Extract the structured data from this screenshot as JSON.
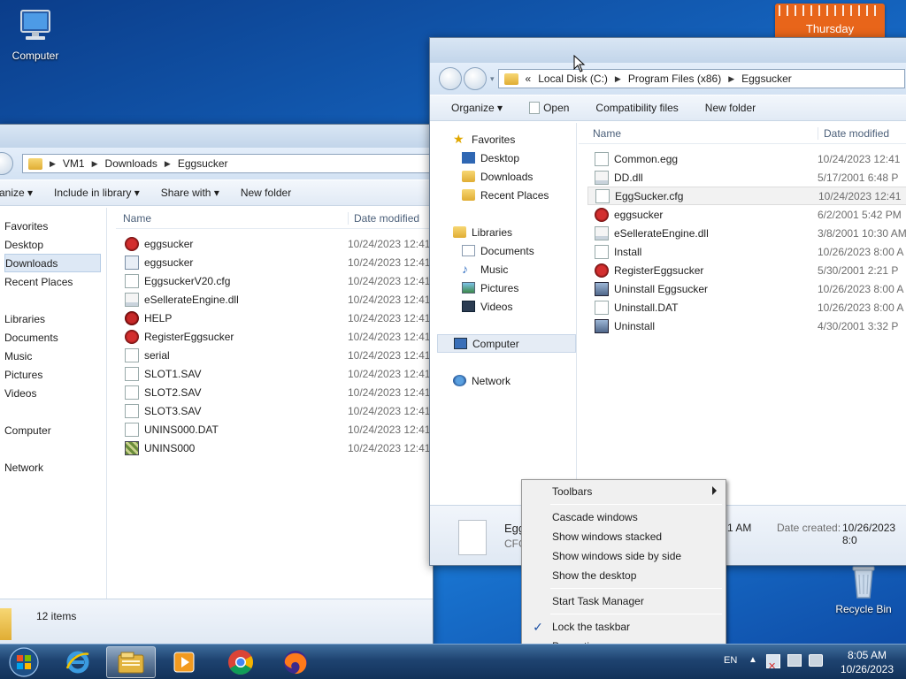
{
  "desktop": {
    "computer_icon_label": "Computer",
    "recycle_bin_label": "Recycle Bin",
    "calendar_day": "Thursday"
  },
  "win_back": {
    "breadcrumb": [
      "VM1",
      "Downloads",
      "Eggsucker"
    ],
    "toolbar": {
      "organize": "anize",
      "include": "Include in library",
      "share": "Share with",
      "new_folder": "New folder"
    },
    "nav": {
      "favorites": "Favorites",
      "fav_items": [
        "Desktop",
        "Downloads",
        "Recent Places"
      ],
      "libraries": "Libraries",
      "lib_items": [
        "Documents",
        "Music",
        "Pictures",
        "Videos"
      ],
      "computer": "Computer",
      "network": "Network"
    },
    "columns": {
      "name": "Name",
      "date": "Date modified"
    },
    "files": [
      {
        "name": "eggsucker",
        "date": "10/24/2023 12:41"
      },
      {
        "name": "eggsucker",
        "date": "10/24/2023 12:41"
      },
      {
        "name": "EggsuckerV20.cfg",
        "date": "10/24/2023 12:41"
      },
      {
        "name": "eSellerateEngine.dll",
        "date": "10/24/2023 12:41"
      },
      {
        "name": "HELP",
        "date": "10/24/2023 12:41"
      },
      {
        "name": "RegisterEggsucker",
        "date": "10/24/2023 12:41"
      },
      {
        "name": "serial",
        "date": "10/24/2023 12:41"
      },
      {
        "name": "SLOT1.SAV",
        "date": "10/24/2023 12:41"
      },
      {
        "name": "SLOT2.SAV",
        "date": "10/24/2023 12:41"
      },
      {
        "name": "SLOT3.SAV",
        "date": "10/24/2023 12:41"
      },
      {
        "name": "UNINS000.DAT",
        "date": "10/24/2023 12:41"
      },
      {
        "name": "UNINS000",
        "date": "10/24/2023 12:41"
      }
    ],
    "status": "12 items"
  },
  "win_front": {
    "breadcrumb_prefix": "«",
    "breadcrumb": [
      "Local Disk (C:)",
      "Program Files (x86)",
      "Eggsucker"
    ],
    "toolbar": {
      "organize": "Organize",
      "open": "Open",
      "compat": "Compatibility files",
      "new_folder": "New folder"
    },
    "nav": {
      "favorites": "Favorites",
      "fav_items": [
        "Desktop",
        "Downloads",
        "Recent Places"
      ],
      "libraries": "Libraries",
      "lib_items": [
        "Documents",
        "Music",
        "Pictures",
        "Videos"
      ],
      "computer": "Computer",
      "network": "Network"
    },
    "columns": {
      "name": "Name",
      "date": "Date modified"
    },
    "files": [
      {
        "name": "Common.egg",
        "date": "10/24/2023 12:41"
      },
      {
        "name": "DD.dll",
        "date": "5/17/2001 6:48 P"
      },
      {
        "name": "EggSucker.cfg",
        "date": "10/24/2023 12:41"
      },
      {
        "name": "eggsucker",
        "date": "6/2/2001 5:42 PM"
      },
      {
        "name": "eSellerateEngine.dll",
        "date": "3/8/2001 10:30 AM"
      },
      {
        "name": "Install",
        "date": "10/26/2023 8:00 A"
      },
      {
        "name": "RegisterEggsucker",
        "date": "5/30/2001 2:21 P"
      },
      {
        "name": "Uninstall Eggsucker",
        "date": "10/26/2023 8:00 A"
      },
      {
        "name": "Uninstall.DAT",
        "date": "10/26/2023 8:00 A"
      },
      {
        "name": "Uninstall",
        "date": "4/30/2001 3:32 P"
      }
    ],
    "details": {
      "name_partial": "Egg",
      "type_partial": "CFG",
      "time_partial": "1 AM",
      "date_created_label": "Date created:",
      "date_created_value": "10/26/2023 8:0"
    }
  },
  "context_menu": {
    "toolbars": "Toolbars",
    "cascade": "Cascade windows",
    "stacked": "Show windows stacked",
    "side_by_side": "Show windows side by side",
    "show_desktop": "Show the desktop",
    "task_manager": "Start Task Manager",
    "lock_taskbar": "Lock the taskbar",
    "properties": "Properties"
  },
  "taskbar": {
    "lang": "EN",
    "time": "8:05 AM",
    "date": "10/26/2023"
  }
}
